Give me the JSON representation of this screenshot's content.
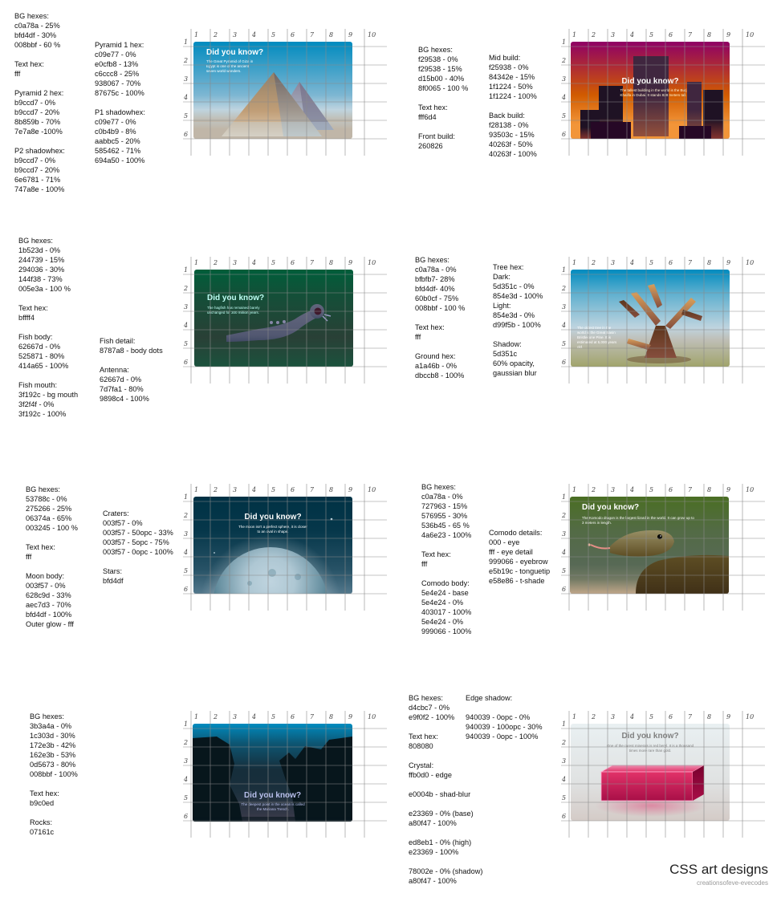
{
  "panels": [
    {
      "id": "pyramids",
      "notes": [
        "BG hexes:\nc0a78a - 25%\nbfd4df - 30%\n008bbf - 60 %\n\nText hex:\nfff\n\nPyramid 2 hex:\nb9ccd7 - 0%\nb9ccd7 - 20%\n8b859b - 70%\n7e7a8e -100%\n\nP2 shadowhex:\nb9ccd7 - 0%\nb9ccd7 - 20%\n6e6781 - 71%\n747a8e - 100%",
        "Pyramid 1 hex:\nc09e77 - 0%\ne0cfb8 - 13%\nc6ccc8 - 25%\n938067 - 70%\n87675c - 100%\n\nP1 shadowhex:\nc09e77 - 0%\nc0b4b9 - 8%\naabbc5 - 20%\n585462 - 71%\n694a50 - 100%"
      ],
      "card": {
        "heading": "Did you know?",
        "text": "The Great Pyramid of Giza in Egypt is one of the ancient seven world wonders."
      }
    },
    {
      "id": "skyline",
      "notes": [
        "BG hexes:\nf29538 - 0%\nf29538 - 15%\nd15b00 - 40%\n8f0065 - 100 %\n\nText hex:\nfff6d4\n\nFront build:\n260826",
        "Mid build:\nf25938 - 0%\n84342e - 15%\n1f1224 - 50%\n1f1224 - 100%\n\nBack build:\nf28138 - 0%\n93503c - 15%\n40263f - 50%\n40263f - 100%"
      ],
      "card": {
        "heading": "Did you know?",
        "text": "The tallest building in the world is the Burj Khalifa in Dubai. It stands 828 meters tall."
      }
    },
    {
      "id": "fish",
      "notes": [
        "BG hexes:\n1b523d - 0%\n244739 - 15%\n294036 - 30%\n144f38 - 73%\n005e3a - 100 %\n\nText hex:\nbffff4\n\nFish body:\n62667d - 0%\n525871 - 80%\n414a65 - 100%\n\nFish mouth:\n3f192c - bg mouth\n3f2f4f - 0%\n3f192c - 100%",
        "Fish detail:\n8787a8 - body dots\n\nAntenna:\n62667d - 0%\n7d7fa1 - 80%\n9898c4 - 100%"
      ],
      "card": {
        "heading": "Did you know?",
        "text": "The hagfish has remained barely unchanged for 300 million years."
      }
    },
    {
      "id": "tree",
      "notes": [
        "BG hexes:\nc0a78a - 0%\nbfbfb7- 28%\nbfd4df- 40%\n60b0cf - 75%\n008bbf - 100 %\n\nText hex:\nfff\n\nGround hex:\na1a46b - 0%\ndbccb8 - 100%",
        "Tree hex:\nDark:\n5d351c - 0%\n854e3d - 100%\nLight:\n854e3d - 0%\nd99f5b - 100%\n\nShadow:\n5d351c\n60% opacity,\ngaussian blur"
      ],
      "card": {
        "heading": "",
        "text": "The oldest tree in the world is the Great Basin Bristlecone Pine. It is estimated at 5,000 years old."
      }
    },
    {
      "id": "moon",
      "notes": [
        "BG hexes:\n53788c - 0%\n275266 - 25%\n06374a - 65%\n003245 - 100 %\n\nText hex:\nfff\n\nMoon body:\n003f57 - 0%\n628c9d - 33%\naec7d3 - 70%\nbfd4df - 100%\nOuter glow - fff",
        "Craters:\n003f57 - 0%\n003f57 - 50opc - 33%\n003f57 - 5opc - 75%\n003f57 - 0opc - 100%\n\nStars:\nbfd4df"
      ],
      "card": {
        "heading": "Did you know?",
        "text": "The moon isn't a perfect sphere, it is closer to an oval in shape."
      }
    },
    {
      "id": "komodo",
      "notes": [
        "BG hexes:\nc0a78a - 0%\n727963 - 15%\n576955 - 30%\n536b45 - 65 %\n4a6e23 - 100%\n\nText hex:\nfff\n\nComodo body:\n5e4e24 - base\n5e4e24 - 0%\n403017 - 100%\n5e4e24 - 0%\n999066 - 100%",
        "Comodo details:\n000 - eye\nfff - eye detail\n999066 - eyebrow\ne5b19c - tonguetip\ne58e86 - t-shade"
      ],
      "card": {
        "heading": "Did you know?",
        "text": "The Komodo dragon is the largest lizard in the world. It can grow up to 3 meters in length."
      }
    },
    {
      "id": "trench",
      "notes": [
        "BG hexes:\n3b3a4a - 0%\n1c303d - 30%\n172e3b - 42%\n162e3b - 53%\n0d5673 - 80%\n008bbf - 100%\n\nText hex:\nb9c0ed\n\nRocks:\n07161c"
      ],
      "card": {
        "heading": "Did you know?",
        "text": "The deepest point in the ocean is called the Mariana Trench."
      }
    },
    {
      "id": "crystal",
      "notes": [
        "BG hexes:\nd4cbc7 - 0%\ne9f0f2 - 100%\n\nText hex:\n808080\n\nCrystal:\nffb0d0 - edge\n\ne0004b - shad-blur\n\ne23369 - 0% (base)\na80f47 - 100%\n\ned8eb1 - 0% (high)\ne23369 - 100%\n\n78002e - 0% (shadow)\na80f47 - 100%",
        "Edge shadow:\n\n940039 - 0opc - 0%\n940039 - 100opc - 30%\n940039 - 0opc - 100%"
      ],
      "card": {
        "heading": "Did you know?",
        "text": "One of the rarest minerals is red beryl. It is a thousand times more rare than gold."
      }
    }
  ],
  "grid": {
    "cols": [
      "1",
      "2",
      "3",
      "4",
      "5",
      "6",
      "7",
      "8",
      "9",
      "10"
    ],
    "rows": [
      "1",
      "2",
      "3",
      "4",
      "5",
      "6"
    ]
  },
  "footer": {
    "title": "CSS art designs",
    "subtitle": "creationsofeve-evecodes"
  },
  "colors": {
    "grid_line": "#8a8a8a",
    "note_text": "#111111"
  }
}
